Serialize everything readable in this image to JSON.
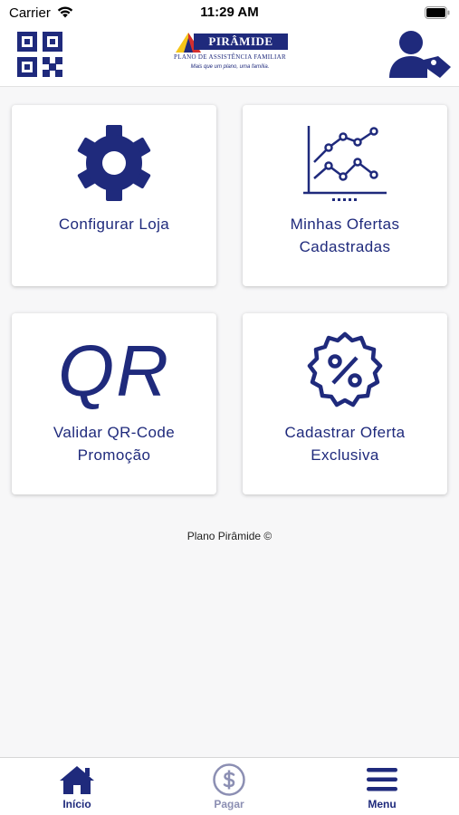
{
  "status_bar": {
    "carrier": "Carrier",
    "time": "11:29 AM"
  },
  "header": {
    "brand_name": "PIRÂMIDE",
    "brand_subtitle": "PLANO DE ASSISTÊNCIA FAMILIAR",
    "brand_tagline": "Mais que um plano, uma família.",
    "colors": {
      "primary": "#1f2a7c",
      "accent_yellow": "#f5c518",
      "accent_red": "#d32f2f"
    }
  },
  "cards": [
    {
      "label": "Configurar Loja",
      "icon": "gear-icon"
    },
    {
      "label": "Minhas Ofertas Cadastradas",
      "icon": "line-chart-icon"
    },
    {
      "label": "Validar QR-Code Promoção",
      "icon": "qr-text-icon",
      "icon_text": "QR"
    },
    {
      "label": "Cadastrar Oferta Exclusiva",
      "icon": "percent-badge-icon"
    }
  ],
  "footer": {
    "text": "Plano Pirâmide ©"
  },
  "tabbar": {
    "items": [
      {
        "label": "Início",
        "icon": "home-icon",
        "active": true
      },
      {
        "label": "Pagar",
        "icon": "dollar-circle-icon",
        "active": false
      },
      {
        "label": "Menu",
        "icon": "hamburger-icon",
        "active": true
      }
    ]
  }
}
